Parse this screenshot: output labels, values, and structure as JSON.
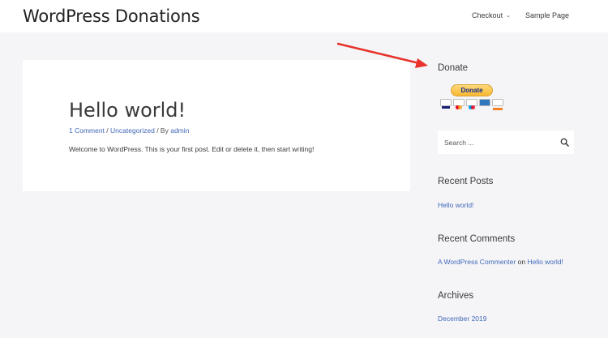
{
  "header": {
    "site_title": "WordPress Donations",
    "nav": [
      {
        "label": "Checkout"
      },
      {
        "label": "Sample Page"
      }
    ]
  },
  "post": {
    "title": "Hello world!",
    "comments_link": "1 Comment",
    "sep1": " / ",
    "category_link": "Uncategorized",
    "sep2": " / By ",
    "author_link": "admin",
    "excerpt": "Welcome to WordPress. This is your first post. Edit or delete it, then start writing!"
  },
  "sidebar": {
    "donate": {
      "title": "Donate",
      "button_label": "Donate",
      "cards": [
        {
          "name": "visa",
          "color": "#1a1f71"
        },
        {
          "name": "mastercard",
          "color": "#eb001b"
        },
        {
          "name": "maestro",
          "color": "#0099df"
        },
        {
          "name": "amex",
          "color": "#2e77bc"
        },
        {
          "name": "discover",
          "color": "#f58220"
        }
      ]
    },
    "search": {
      "placeholder": "Search ..."
    },
    "recent_posts": {
      "title": "Recent Posts",
      "items": [
        "Hello world!"
      ]
    },
    "recent_comments": {
      "title": "Recent Comments",
      "author": "A WordPress Commenter",
      "on": "on",
      "post": "Hello world!"
    },
    "archives": {
      "title": "Archives",
      "items": [
        "December 2019"
      ]
    }
  },
  "colors": {
    "link": "#4169b8",
    "arrow": "#e8322a",
    "page_bg": "#f5f5f8"
  }
}
